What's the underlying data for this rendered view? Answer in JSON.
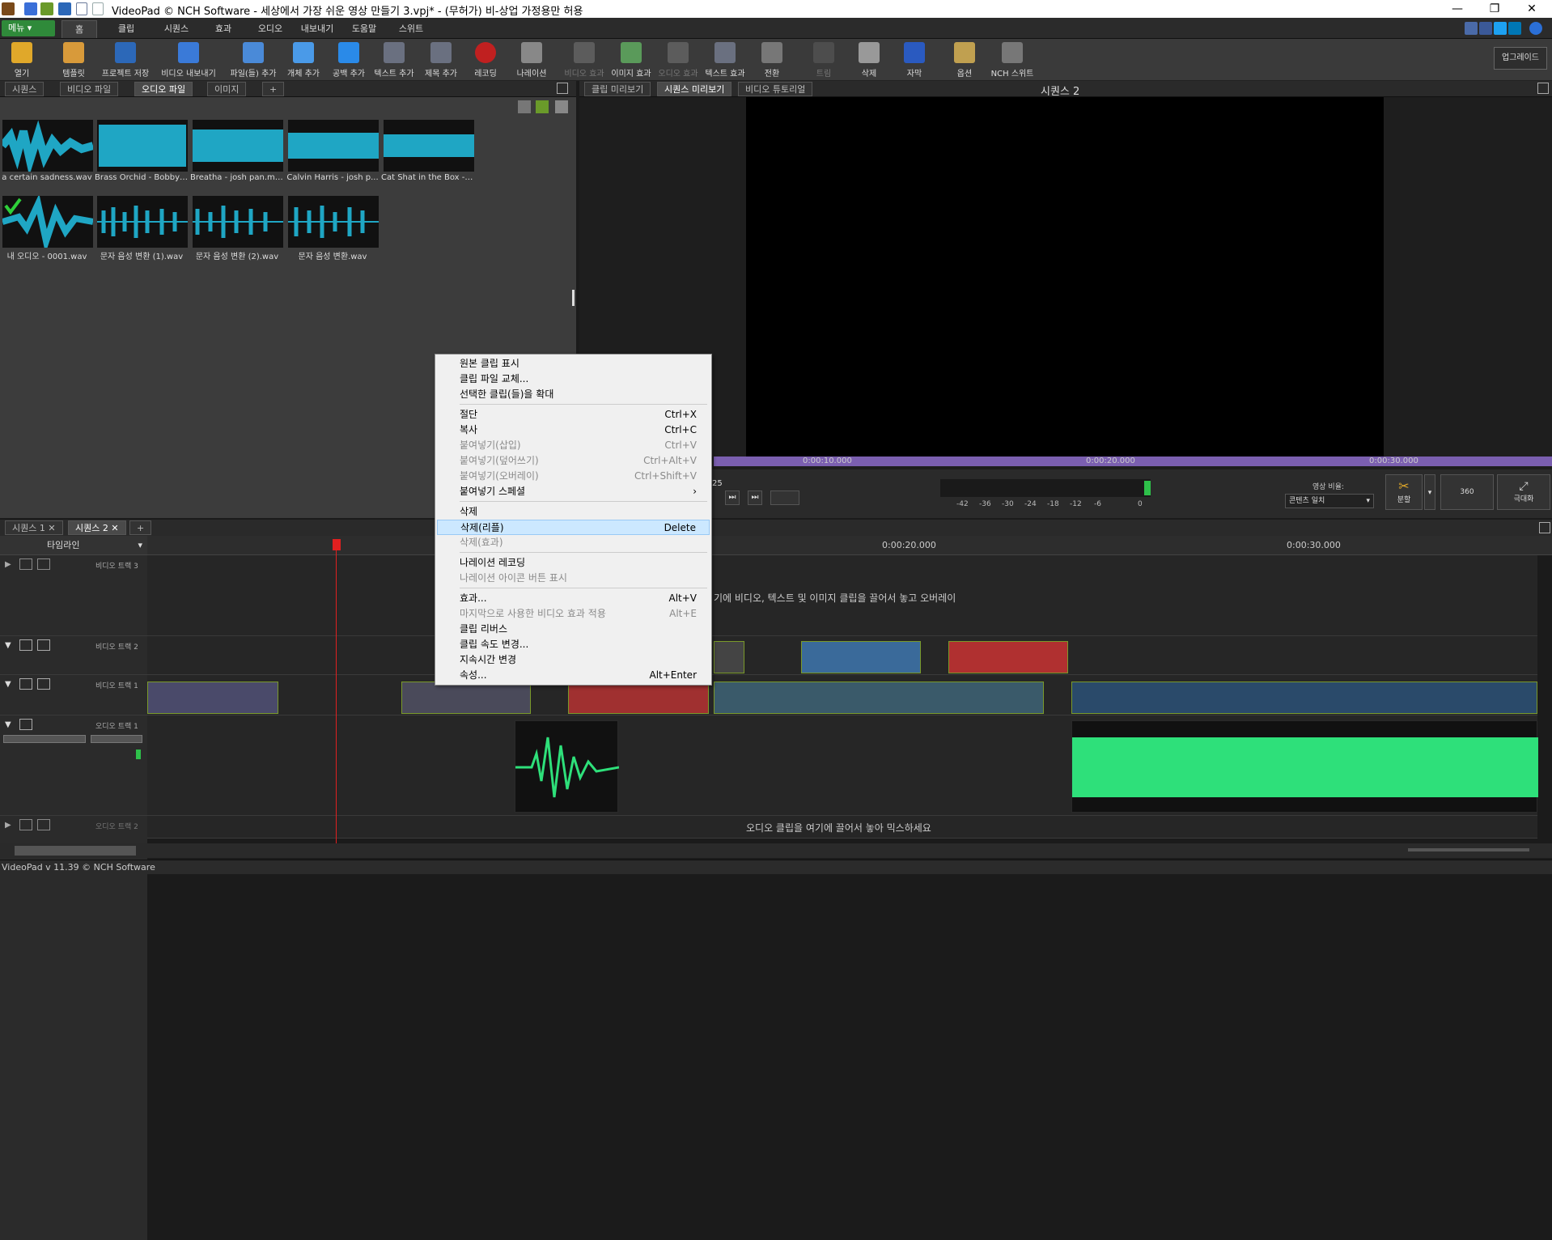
{
  "window": {
    "title": "VideoPad © NCH Software - 세상에서 가장 쉬운 영상 만들기 3.vpj* - (무허가) 비-상업 가정용만 허용"
  },
  "menu": {
    "button_label": "메뉴 ▾",
    "tabs": [
      "홈",
      "클립",
      "시퀀스",
      "효과",
      "오디오",
      "내보내기",
      "도움말",
      "스위트"
    ],
    "active": "홈"
  },
  "toolbar": {
    "items": [
      {
        "label": "열기",
        "icon": "folder-open-icon",
        "enabled": true
      },
      {
        "label": "템플릿",
        "icon": "template-icon",
        "enabled": true
      },
      {
        "label": "프로젝트 저장",
        "icon": "save-icon",
        "enabled": true
      },
      {
        "label": "비디오 내보내기",
        "icon": "export-video-icon",
        "enabled": true
      },
      {
        "label": "파일(들) 추가",
        "icon": "add-files-icon",
        "enabled": true
      },
      {
        "label": "개체 추가",
        "icon": "add-object-icon",
        "enabled": true
      },
      {
        "label": "공백 추가",
        "icon": "add-blank-icon",
        "enabled": true
      },
      {
        "label": "텍스트 추가",
        "icon": "add-text-icon",
        "enabled": true
      },
      {
        "label": "제목 추가",
        "icon": "add-title-icon",
        "enabled": true
      },
      {
        "label": "레코딩",
        "icon": "record-icon",
        "enabled": true
      },
      {
        "label": "나레이션",
        "icon": "narration-mic-icon",
        "enabled": true
      },
      {
        "label": "비디오 효과",
        "icon": "video-effects-icon",
        "enabled": false
      },
      {
        "label": "이미지 효과",
        "icon": "image-effects-icon",
        "enabled": true
      },
      {
        "label": "오디오 효과",
        "icon": "audio-effects-icon",
        "enabled": false
      },
      {
        "label": "텍스트 효과",
        "icon": "text-effects-icon",
        "enabled": true
      },
      {
        "label": "전환",
        "icon": "transition-icon",
        "enabled": true
      },
      {
        "label": "트림",
        "icon": "trim-icon",
        "enabled": false
      },
      {
        "label": "삭제",
        "icon": "trash-icon",
        "enabled": true
      },
      {
        "label": "자막",
        "icon": "subtitle-icon",
        "enabled": true
      },
      {
        "label": "옵션",
        "icon": "options-tools-icon",
        "enabled": true
      },
      {
        "label": "NCH 스위트",
        "icon": "nch-suite-icon",
        "enabled": true
      }
    ],
    "upgrade_label": "업그레이드"
  },
  "bin_tabs": [
    "시퀀스",
    "비디오 파일",
    "오디오 파일",
    "이미지",
    "+"
  ],
  "bin_active": "오디오 파일",
  "audio_files": [
    {
      "name": "a certain sadness.wav"
    },
    {
      "name": "Brass Orchid - Bobby ..."
    },
    {
      "name": "Breatha - josh pan.mp3"
    },
    {
      "name": "Calvin Harris - josh p..."
    },
    {
      "name": "Cat Shat in the Box - J..."
    },
    {
      "name": "내 오디오 - 0001.wav",
      "checked": true
    },
    {
      "name": "문자 음성 변환 (1).wav"
    },
    {
      "name": "문자 음성 변환 (2).wav"
    },
    {
      "name": "문자 음성 변환.wav"
    }
  ],
  "preview_tabs": [
    "클립 미리보기",
    "시퀀스 미리보기",
    "비디오 튜토리얼"
  ],
  "preview_active": "시퀀스 미리보기",
  "preview_title": "시퀀스 2",
  "preview_ruler": [
    "0:00:10.000",
    "0:00:20.000",
    "0:00:30.000"
  ],
  "preview_time_fragment": "25",
  "meter_ticks": [
    "-42",
    "-36",
    "-30",
    "-24",
    "-18",
    "-12",
    "-6",
    "0"
  ],
  "aspect": {
    "label": "영상 비율:",
    "value": "콘텐츠 일치"
  },
  "right_buttons": [
    {
      "label": "분할"
    },
    {
      "label": "360"
    },
    {
      "label": "극대화"
    }
  ],
  "timeline_tabs": [
    "시퀀스 1",
    "시퀀스 2",
    "+"
  ],
  "timeline_active": "시퀀스 2",
  "timeline_mode": "타임라인",
  "timeline_ruler": [
    "0:00:20.000",
    "0:00:30.000"
  ],
  "tracks": {
    "video3": "비디오 트랙 3",
    "video2": "비디오 트랙 2",
    "video1": "비디오 트랙 1",
    "audio1": "오디오 트랙 1",
    "audio2": "오디오 트랙 2"
  },
  "overlay_hint": "기에 비디오, 텍스트 및 이미지 클립을 끌어서 놓고 오버레이",
  "audio_hint": "오디오 클립을 여기에 끌어서 놓아 믹스하세요",
  "context_menu": [
    {
      "label": "원본 클립 표시",
      "shortcut": "",
      "enabled": true
    },
    {
      "label": "클립 파일 교체...",
      "shortcut": "",
      "enabled": true
    },
    {
      "label": "선택한 클립(들)을 확대",
      "shortcut": "",
      "enabled": true
    },
    {
      "sep": true
    },
    {
      "label": "절단",
      "shortcut": "Ctrl+X",
      "enabled": true
    },
    {
      "label": "복사",
      "shortcut": "Ctrl+C",
      "enabled": true
    },
    {
      "label": "붙여넣기(삽입)",
      "shortcut": "Ctrl+V",
      "enabled": false
    },
    {
      "label": "붙여넣기(덮어쓰기)",
      "shortcut": "Ctrl+Alt+V",
      "enabled": false
    },
    {
      "label": "붙여넣기(오버레이)",
      "shortcut": "Ctrl+Shift+V",
      "enabled": false
    },
    {
      "label": "붙여넣기 스페셜",
      "shortcut": "›",
      "enabled": true
    },
    {
      "sep": true
    },
    {
      "label": "삭제",
      "shortcut": "",
      "enabled": true
    },
    {
      "label": "삭제(리플)",
      "shortcut": "Delete",
      "enabled": true,
      "highlight": true
    },
    {
      "label": "삭제(효과)",
      "shortcut": "",
      "enabled": false
    },
    {
      "sep": true
    },
    {
      "label": "나레이션 레코딩",
      "shortcut": "",
      "enabled": true
    },
    {
      "label": "나레이션 아이콘 버튼 표시",
      "shortcut": "",
      "enabled": false
    },
    {
      "sep": true
    },
    {
      "label": "효과...",
      "shortcut": "Alt+V",
      "enabled": true
    },
    {
      "label": "마지막으로 사용한 비디오 효과 적용",
      "shortcut": "Alt+E",
      "enabled": false
    },
    {
      "label": "클립 리버스",
      "shortcut": "",
      "enabled": true
    },
    {
      "label": "클립 속도 변경...",
      "shortcut": "",
      "enabled": true
    },
    {
      "label": "지속시간 변경",
      "shortcut": "",
      "enabled": true
    },
    {
      "label": "속성...",
      "shortcut": "Alt+Enter",
      "enabled": true
    }
  ],
  "status": {
    "left": "VideoPad v 11.39 © NCH Software"
  },
  "colors": {
    "accent_green": "#2f8a3a",
    "waveform_blue": "#1fa6c4",
    "waveform_green": "#2ee07a",
    "playhead": "#e02020",
    "ruler_purple": "#7b5fb0"
  }
}
